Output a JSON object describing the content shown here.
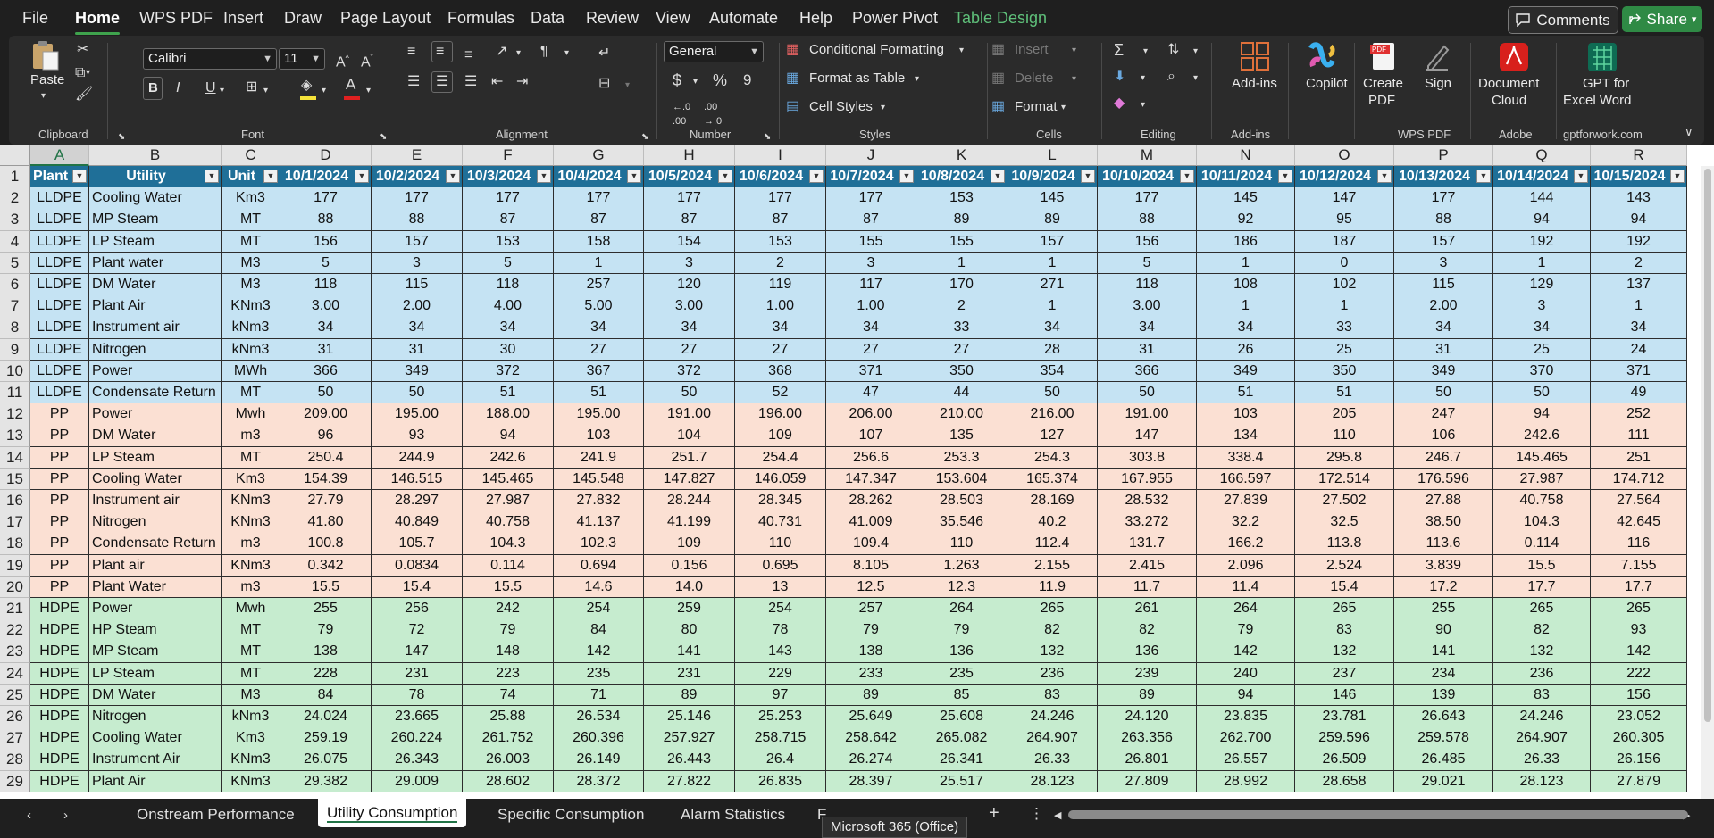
{
  "menu": {
    "items": [
      "File",
      "Home",
      "WPS PDF",
      "Insert",
      "Draw",
      "Page Layout",
      "Formulas",
      "Data",
      "Review",
      "View",
      "Automate",
      "Help",
      "Power Pivot",
      "Table Design"
    ],
    "comments_label": "Comments",
    "share_label": "Share"
  },
  "ribbon": {
    "clipboard": {
      "paste": "Paste",
      "label": "Clipboard"
    },
    "font": {
      "name": "Calibri",
      "size": "11",
      "label": "Font",
      "bold": "B",
      "italic": "I",
      "underline": "U"
    },
    "alignment": {
      "label": "Alignment"
    },
    "number": {
      "format": "General",
      "label": "Number",
      "currency": "$",
      "percent": "%",
      "comma": "9"
    },
    "styles": {
      "conditional_formatting": "Conditional Formatting",
      "format_as_table": "Format as Table",
      "cell_styles": "Cell Styles",
      "label": "Styles"
    },
    "cells": {
      "insert": "Insert",
      "delete": "Delete",
      "format": "Format",
      "label": "Cells"
    },
    "editing": {
      "label": "Editing"
    },
    "addins": {
      "addins": "Add-ins",
      "label": "Add-ins"
    },
    "copilot": {
      "label": "Copilot"
    },
    "wps": {
      "create_pdf_1": "Create",
      "create_pdf_2": "PDF",
      "sign": "Sign",
      "label": "WPS PDF"
    },
    "adobe": {
      "document_1": "Document",
      "document_2": "Cloud",
      "label": "Adobe"
    },
    "gpt": {
      "line1": "GPT for",
      "line2": "Excel Word",
      "label": "gptforwork.com"
    }
  },
  "grid": {
    "columns": [
      "A",
      "B",
      "C",
      "D",
      "E",
      "F",
      "G",
      "H",
      "I",
      "J",
      "K",
      "L",
      "M",
      "N",
      "O",
      "P",
      "Q",
      "R"
    ],
    "selected_column": "A",
    "header_row": [
      "Plant",
      "Utility",
      "Unit",
      "10/1/2024",
      "10/2/2024",
      "10/3/2024",
      "10/4/2024",
      "10/5/2024",
      "10/6/2024",
      "10/7/2024",
      "10/8/2024",
      "10/9/2024",
      "10/10/2024",
      "10/11/2024",
      "10/12/2024",
      "10/13/2024",
      "10/14/2024",
      "10/15/2024"
    ],
    "group_colors": {
      "LLDPE": "#c5e3f3",
      "PP": "#fbe0d3",
      "HDPE": "#c6eccf"
    },
    "rows": [
      [
        "LLDPE",
        "Cooling Water",
        "Km3",
        "177",
        "177",
        "177",
        "177",
        "177",
        "177",
        "177",
        "153",
        "145",
        "177",
        "145",
        "147",
        "177",
        "144",
        "143"
      ],
      [
        "LLDPE",
        "MP Steam",
        "MT",
        "88",
        "88",
        "87",
        "87",
        "87",
        "87",
        "87",
        "89",
        "89",
        "88",
        "92",
        "95",
        "88",
        "94",
        "94"
      ],
      [
        "LLDPE",
        "LP Steam",
        "MT",
        "156",
        "157",
        "153",
        "158",
        "154",
        "153",
        "155",
        "155",
        "157",
        "156",
        "186",
        "187",
        "157",
        "192",
        "192"
      ],
      [
        "LLDPE",
        "Plant water",
        "M3",
        "5",
        "3",
        "5",
        "1",
        "3",
        "2",
        "3",
        "1",
        "1",
        "5",
        "1",
        "0",
        "3",
        "1",
        "2"
      ],
      [
        "LLDPE",
        "DM Water",
        "M3",
        "118",
        "115",
        "118",
        "257",
        "120",
        "119",
        "117",
        "170",
        "271",
        "118",
        "108",
        "102",
        "115",
        "129",
        "137"
      ],
      [
        "LLDPE",
        "Plant Air",
        "KNm3",
        "3.00",
        "2.00",
        "4.00",
        "5.00",
        "3.00",
        "1.00",
        "1.00",
        "2",
        "1",
        "3.00",
        "1",
        "1",
        "2.00",
        "3",
        "1"
      ],
      [
        "LLDPE",
        "Instrument air",
        "kNm3",
        "34",
        "34",
        "34",
        "34",
        "34",
        "34",
        "34",
        "33",
        "34",
        "34",
        "34",
        "33",
        "34",
        "34",
        "34"
      ],
      [
        "LLDPE",
        "Nitrogen",
        "kNm3",
        "31",
        "31",
        "30",
        "27",
        "27",
        "27",
        "27",
        "27",
        "28",
        "31",
        "26",
        "25",
        "31",
        "25",
        "24"
      ],
      [
        "LLDPE",
        "Power",
        "MWh",
        "366",
        "349",
        "372",
        "367",
        "372",
        "368",
        "371",
        "350",
        "354",
        "366",
        "349",
        "350",
        "349",
        "370",
        "371"
      ],
      [
        "LLDPE",
        "Condensate Return",
        "MT",
        "50",
        "50",
        "51",
        "51",
        "50",
        "52",
        "47",
        "44",
        "50",
        "50",
        "51",
        "51",
        "50",
        "50",
        "49"
      ],
      [
        "PP",
        "Power",
        "Mwh",
        "209.00",
        "195.00",
        "188.00",
        "195.00",
        "191.00",
        "196.00",
        "206.00",
        "210.00",
        "216.00",
        "191.00",
        "103",
        "205",
        "247",
        "94",
        "252"
      ],
      [
        "PP",
        "DM Water",
        "m3",
        "96",
        "93",
        "94",
        "103",
        "104",
        "109",
        "107",
        "135",
        "127",
        "147",
        "134",
        "110",
        "106",
        "242.6",
        "111"
      ],
      [
        "PP",
        "LP Steam",
        "MT",
        "250.4",
        "244.9",
        "242.6",
        "241.9",
        "251.7",
        "254.4",
        "256.6",
        "253.3",
        "254.3",
        "303.8",
        "338.4",
        "295.8",
        "246.7",
        "145.465",
        "251"
      ],
      [
        "PP",
        "Cooling Water",
        "Km3",
        "154.39",
        "146.515",
        "145.465",
        "145.548",
        "147.827",
        "146.059",
        "147.347",
        "153.604",
        "165.374",
        "167.955",
        "166.597",
        "172.514",
        "176.596",
        "27.987",
        "174.712"
      ],
      [
        "PP",
        "Instrument air",
        "KNm3",
        "27.79",
        "28.297",
        "27.987",
        "27.832",
        "28.244",
        "28.345",
        "28.262",
        "28.503",
        "28.169",
        "28.532",
        "27.839",
        "27.502",
        "27.88",
        "40.758",
        "27.564"
      ],
      [
        "PP",
        "Nitrogen",
        "KNm3",
        "41.80",
        "40.849",
        "40.758",
        "41.137",
        "41.199",
        "40.731",
        "41.009",
        "35.546",
        "40.2",
        "33.272",
        "32.2",
        "32.5",
        "38.50",
        "104.3",
        "42.645"
      ],
      [
        "PP",
        "Condensate Return",
        "m3",
        "100.8",
        "105.7",
        "104.3",
        "102.3",
        "109",
        "110",
        "109.4",
        "110",
        "112.4",
        "131.7",
        "166.2",
        "113.8",
        "113.6",
        "0.114",
        "116"
      ],
      [
        "PP",
        "Plant air",
        "KNm3",
        "0.342",
        "0.0834",
        "0.114",
        "0.694",
        "0.156",
        "0.695",
        "8.105",
        "1.263",
        "2.155",
        "2.415",
        "2.096",
        "2.524",
        "3.839",
        "15.5",
        "7.155"
      ],
      [
        "PP",
        "Plant Water",
        "m3",
        "15.5",
        "15.4",
        "15.5",
        "14.6",
        "14.0",
        "13",
        "12.5",
        "12.3",
        "11.9",
        "11.7",
        "11.4",
        "15.4",
        "17.2",
        "17.7",
        "17.7"
      ],
      [
        "HDPE",
        "Power",
        "Mwh",
        "255",
        "256",
        "242",
        "254",
        "259",
        "254",
        "257",
        "264",
        "265",
        "261",
        "264",
        "265",
        "255",
        "265",
        "265"
      ],
      [
        "HDPE",
        "HP Steam",
        "MT",
        "79",
        "72",
        "79",
        "84",
        "80",
        "78",
        "79",
        "79",
        "82",
        "82",
        "79",
        "83",
        "90",
        "82",
        "93"
      ],
      [
        "HDPE",
        "MP Steam",
        "MT",
        "138",
        "147",
        "148",
        "142",
        "141",
        "143",
        "138",
        "136",
        "132",
        "136",
        "142",
        "132",
        "141",
        "132",
        "142"
      ],
      [
        "HDPE",
        "LP Steam",
        "MT",
        "228",
        "231",
        "223",
        "235",
        "231",
        "229",
        "233",
        "235",
        "236",
        "239",
        "240",
        "237",
        "234",
        "236",
        "222"
      ],
      [
        "HDPE",
        "DM Water",
        "M3",
        "84",
        "78",
        "74",
        "71",
        "89",
        "97",
        "89",
        "85",
        "83",
        "89",
        "94",
        "146",
        "139",
        "83",
        "156"
      ],
      [
        "HDPE",
        "Nitrogen",
        "kNm3",
        "24.024",
        "23.665",
        "25.88",
        "26.534",
        "25.146",
        "25.253",
        "25.649",
        "25.608",
        "24.246",
        "24.120",
        "23.835",
        "23.781",
        "26.643",
        "24.246",
        "23.052"
      ],
      [
        "HDPE",
        "Cooling Water",
        "Km3",
        "259.19",
        "260.224",
        "261.752",
        "260.396",
        "257.927",
        "258.715",
        "258.642",
        "265.082",
        "264.907",
        "263.356",
        "262.700",
        "259.596",
        "259.578",
        "264.907",
        "260.305"
      ],
      [
        "HDPE",
        "Instrument Air",
        "KNm3",
        "26.075",
        "26.343",
        "26.003",
        "26.149",
        "26.443",
        "26.4",
        "26.274",
        "26.341",
        "26.33",
        "26.801",
        "26.557",
        "26.509",
        "26.485",
        "26.33",
        "26.156"
      ],
      [
        "HDPE",
        "Plant Air",
        "KNm3",
        "29.382",
        "29.009",
        "28.602",
        "28.372",
        "27.822",
        "26.835",
        "28.397",
        "25.517",
        "28.123",
        "27.809",
        "28.992",
        "28.658",
        "29.021",
        "28.123",
        "27.879"
      ]
    ]
  },
  "sheets": {
    "tabs": [
      "Onstream Performance",
      "Utility Consumption",
      "Specific Consumption",
      "Alarm Statistics",
      "F"
    ],
    "active": "Utility Consumption",
    "tooltip": "Microsoft 365 (Office)"
  },
  "colors": {
    "accent": "#217346",
    "header_fill": "#1f6f98",
    "share": "#2f8a45"
  }
}
